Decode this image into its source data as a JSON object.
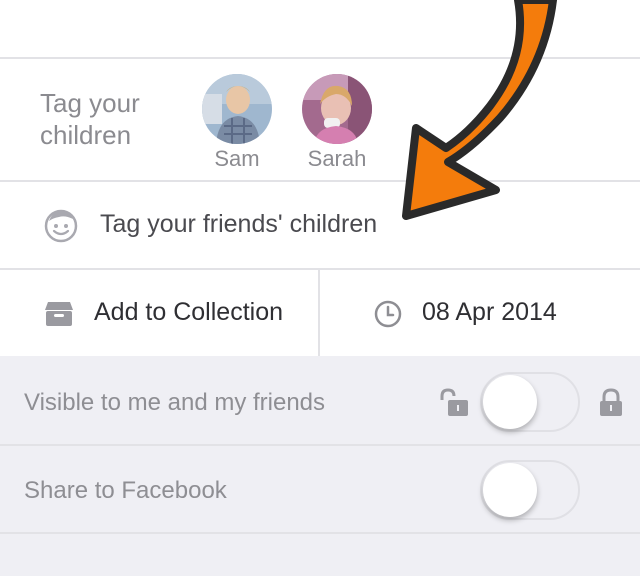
{
  "tag_children": {
    "label": "Tag your children",
    "children": [
      {
        "name": "Sam"
      },
      {
        "name": "Sarah"
      }
    ]
  },
  "tag_friends": {
    "label": "Tag your friends' children",
    "icon": "smiley-face-icon"
  },
  "collection": {
    "label": "Add to Collection",
    "icon": "collection-box-icon"
  },
  "date": {
    "label": "08 Apr 2014",
    "icon": "clock-icon"
  },
  "settings": {
    "visibility": {
      "label": "Visible to me and my friends",
      "enabled": false
    },
    "facebook": {
      "label": "Share to Facebook",
      "enabled": false
    }
  },
  "colors": {
    "arrow_fill": "#f47c0c",
    "arrow_outline": "#2a2a2a",
    "settings_bg": "#efeff4"
  }
}
